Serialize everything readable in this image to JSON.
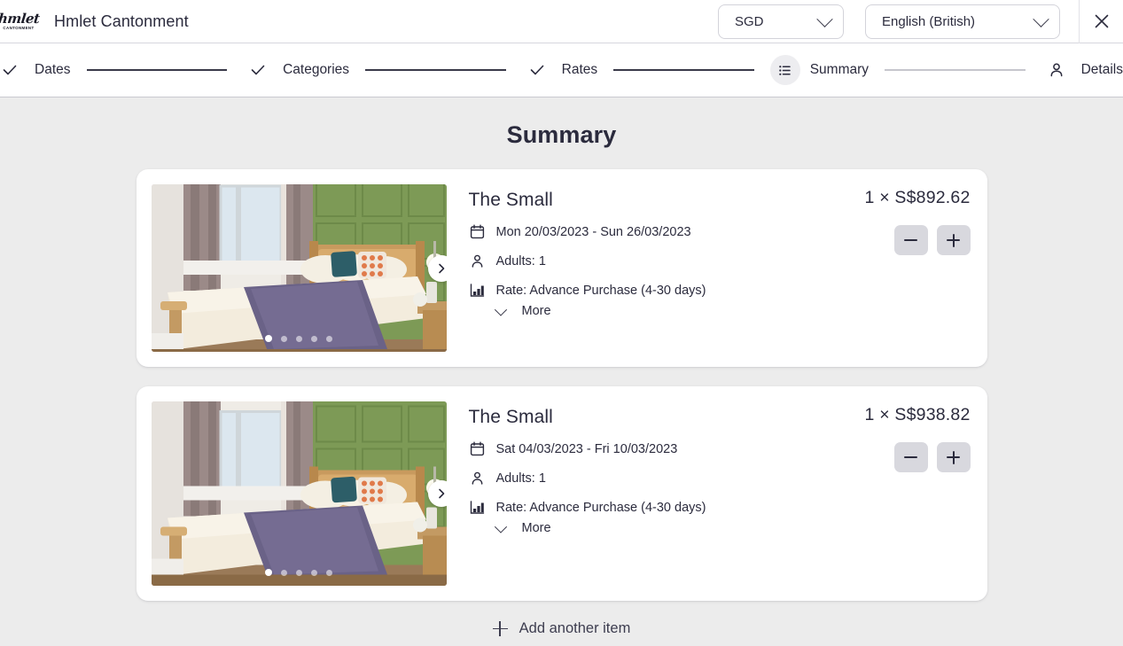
{
  "header": {
    "logo_script": "hmlet",
    "logo_sub": "CANTONMENT",
    "property_title": "Hmlet Cantonment",
    "currency": {
      "value": "SGD",
      "icon": "chevron-down-icon"
    },
    "language": {
      "value": "English (British)",
      "icon": "chevron-down-icon"
    },
    "close_icon": "close-icon"
  },
  "stepper": {
    "steps": [
      {
        "label": "Dates",
        "icon": "check-icon",
        "state": "done"
      },
      {
        "label": "Categories",
        "icon": "check-icon",
        "state": "done"
      },
      {
        "label": "Rates",
        "icon": "check-icon",
        "state": "done"
      },
      {
        "label": "Summary",
        "icon": "list-icon",
        "state": "active"
      },
      {
        "label": "Details",
        "icon": "person-icon",
        "state": "todo"
      }
    ]
  },
  "main": {
    "title": "Summary",
    "items": [
      {
        "name": "The Small",
        "dates": "Mon 20/03/2023 - Sun 26/03/2023",
        "guests": "Adults: 1",
        "rate": "Rate: Advance Purchase (4-30 days)",
        "more_label": "More",
        "price": "1 × S$892.62",
        "quantity": 1,
        "carousel": {
          "dots": 5,
          "active_dot": 0,
          "next_icon": "chevron-right-icon"
        },
        "icons": {
          "dates": "calendar-icon",
          "guests": "person-icon",
          "rate": "bar-chart-icon",
          "more": "chevron-down-icon",
          "decrement": "minus-icon",
          "increment": "plus-icon"
        }
      },
      {
        "name": "The Small",
        "dates": "Sat 04/03/2023 - Fri 10/03/2023",
        "guests": "Adults: 1",
        "rate": "Rate: Advance Purchase (4-30 days)",
        "more_label": "More",
        "price": "1 × S$938.82",
        "quantity": 1,
        "carousel": {
          "dots": 5,
          "active_dot": 0,
          "next_icon": "chevron-right-icon"
        },
        "icons": {
          "dates": "calendar-icon",
          "guests": "person-icon",
          "rate": "bar-chart-icon",
          "more": "chevron-down-icon",
          "decrement": "minus-icon",
          "increment": "plus-icon"
        }
      }
    ],
    "add_item_label": "Add another item",
    "add_item_icon": "plus-icon"
  },
  "colors": {
    "page_background": "#ececec",
    "card_background": "#ffffff",
    "text": "#2b2b3d",
    "step_done_line": "#3a3a4a",
    "step_todo_line": "#c6c6cd",
    "qty_button": "#d8d8de"
  }
}
